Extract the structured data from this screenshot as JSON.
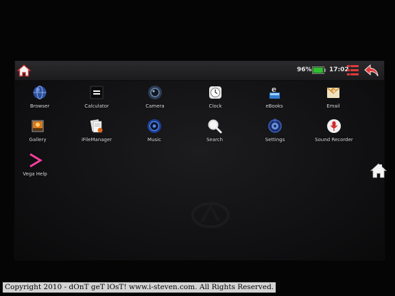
{
  "status_bar": {
    "battery_percent": "96%",
    "battery_level": 0.96,
    "battery_color": "#2fbf2f",
    "time": "17:02",
    "icons": [
      "home-icon",
      "battery-icon",
      "menu-list-icon",
      "back-arrow-icon"
    ]
  },
  "apps": [
    {
      "label": "Browser",
      "icon": "globe-icon"
    },
    {
      "label": "Calculator",
      "icon": "calculator-icon"
    },
    {
      "label": "Camera",
      "icon": "camera-icon"
    },
    {
      "label": "Clock",
      "icon": "clock-icon"
    },
    {
      "label": "eBooks",
      "icon": "ebook-icon"
    },
    {
      "label": "Email",
      "icon": "envelope-icon"
    },
    {
      "label": "Gallery",
      "icon": "picture-icon"
    },
    {
      "label": "iFileManager",
      "icon": "file-manager-icon"
    },
    {
      "label": "Music",
      "icon": "speaker-icon"
    },
    {
      "label": "Search",
      "icon": "magnifier-icon"
    },
    {
      "label": "Settings",
      "icon": "gear-icon"
    },
    {
      "label": "Sound Recorder",
      "icon": "microphone-icon"
    },
    {
      "label": "Vega Help",
      "icon": "chevron-right-icon"
    }
  ],
  "side_home_icon": "home-icon",
  "copyright": "Copyright 2010 - dOnT geT lOsT! www.i-steven.com. All Rights Reserved.",
  "colors": {
    "accent_red": "#e23a3a",
    "status_bar": "#222224",
    "screen_bg": "#141416"
  }
}
